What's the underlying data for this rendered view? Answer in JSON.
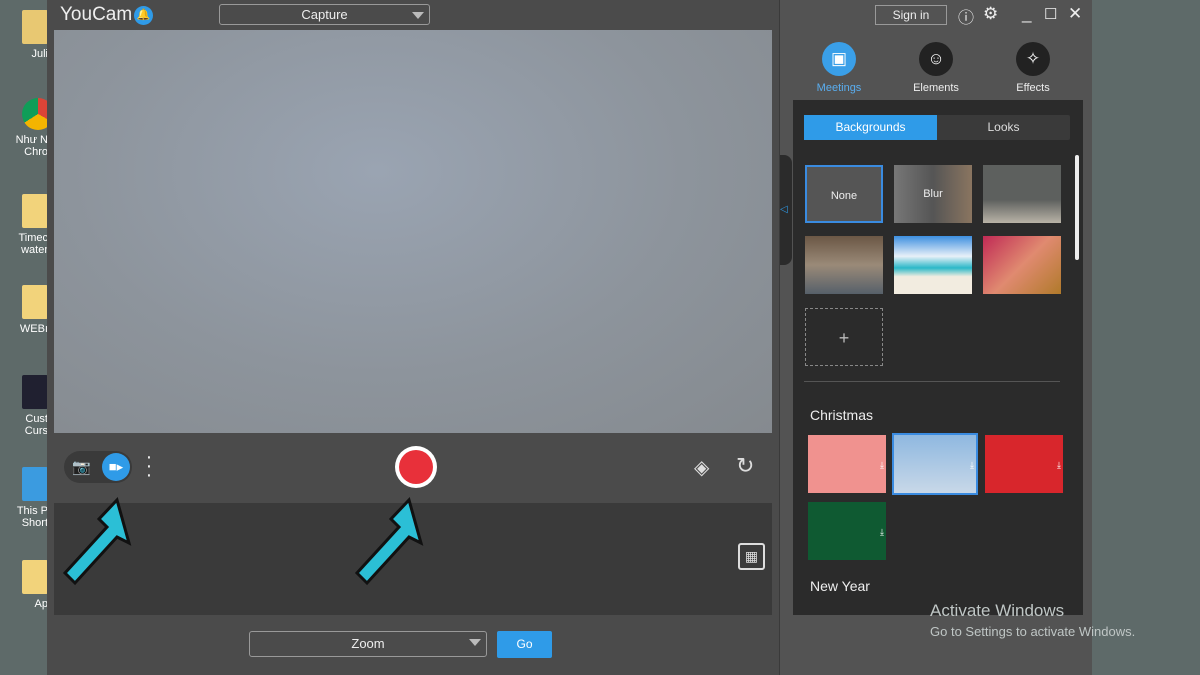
{
  "desktop": {
    "icons": [
      {
        "label": "Juli",
        "color": "#e8c872"
      },
      {
        "label": "Như N Chro",
        "color": "#db4437"
      },
      {
        "label": "Timec water",
        "color": "#f2d37b"
      },
      {
        "label": "WEBı",
        "color": "#f2d37b"
      },
      {
        "label": "Cust Curs",
        "color": "#202030"
      },
      {
        "label": "This P Short",
        "color": "#3b9be0"
      },
      {
        "label": "Ap",
        "color": "#f2d37b"
      }
    ]
  },
  "app": {
    "name": "YouCam",
    "mode": "Capture",
    "accent": "#2f9be8",
    "record_color": "#e8303a"
  },
  "controls": {
    "capture_mode": "video"
  },
  "bottom": {
    "meeting_app": "Zoom",
    "go_label": "Go"
  },
  "window": {
    "sign_in": "Sign in"
  },
  "nav": [
    {
      "label": "Meetings",
      "active": true
    },
    {
      "label": "Elements"
    },
    {
      "label": "Effects"
    }
  ],
  "tabs": [
    {
      "label": "Backgrounds",
      "active": true
    },
    {
      "label": "Looks"
    }
  ],
  "backgrounds": {
    "none": "None",
    "blur": "Blur",
    "add": "+"
  },
  "sections": {
    "christmas": "Christmas",
    "new_year": "New Year"
  },
  "watermark": {
    "title": "Activate Windows",
    "subtitle": "Go to Settings to activate Windows."
  }
}
